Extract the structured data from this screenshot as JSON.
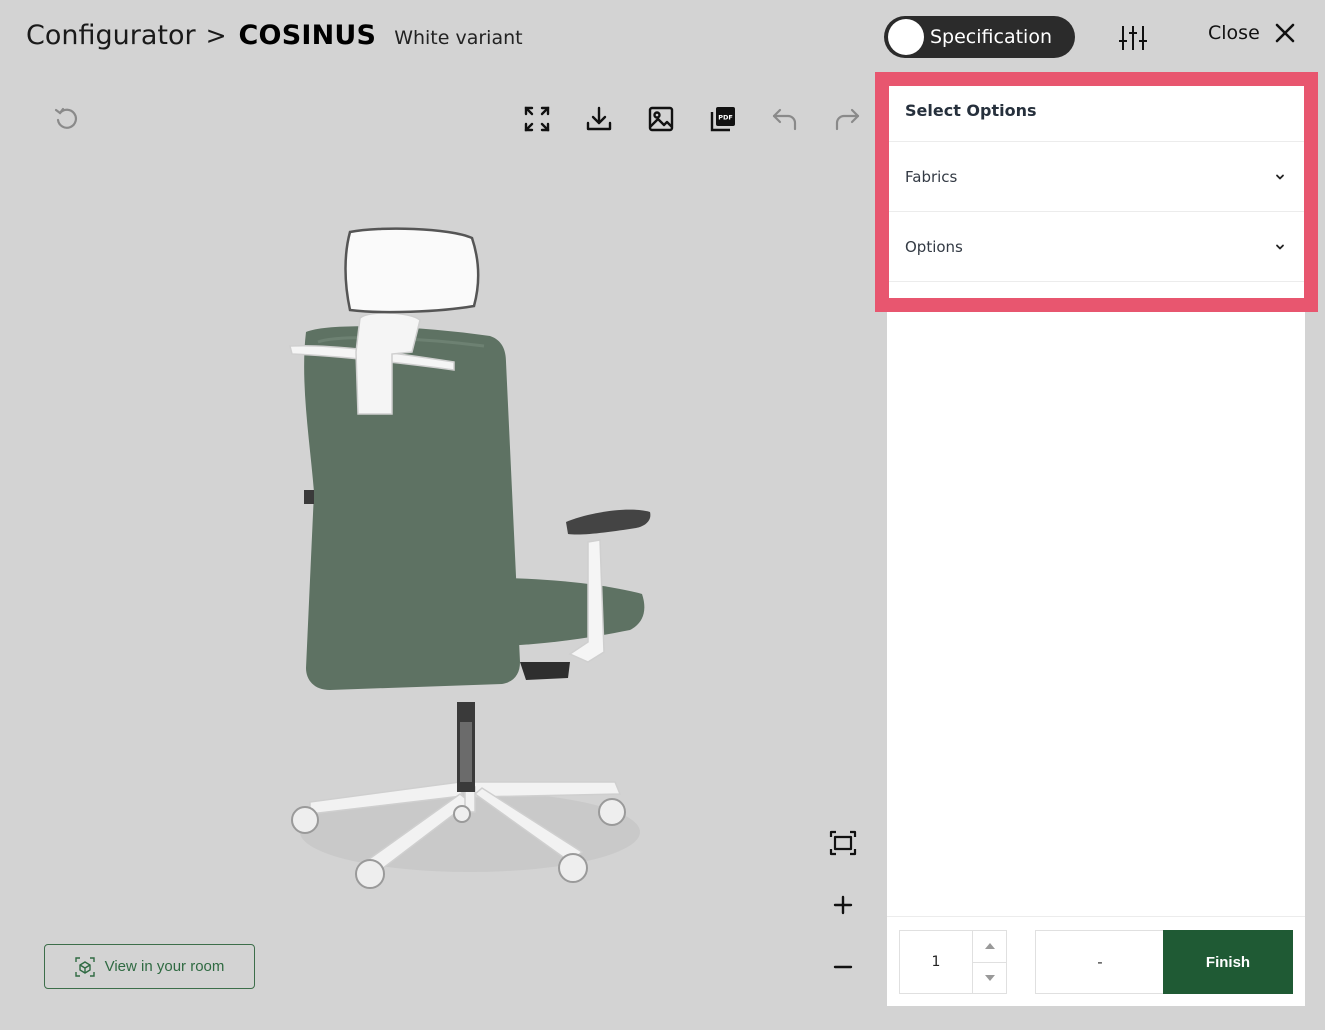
{
  "header": {
    "breadcrumb_root": "Configurator",
    "separator": ">",
    "product_name": "COSINUS",
    "variant": "White variant",
    "spec_toggle_label": "Specification",
    "close_label": "Close"
  },
  "toolbar": {
    "icons": [
      "reset-icon",
      "fullscreen-icon",
      "download-icon",
      "image-icon",
      "pdf-icon",
      "undo-icon",
      "redo-icon"
    ]
  },
  "viewer": {
    "chair_fabric_color": "#5e7263",
    "frame_color": "#f5f5f5",
    "room_button_label": "View in your room"
  },
  "panel": {
    "title": "Select Options",
    "sections": [
      {
        "label": "Fabrics"
      },
      {
        "label": "Options"
      }
    ]
  },
  "footer": {
    "quantity": "1",
    "price": "-",
    "finish_label": "Finish"
  },
  "colors": {
    "background": "#d3d3d3",
    "accent_green": "#1f5a34",
    "highlight": "#e8566f"
  }
}
